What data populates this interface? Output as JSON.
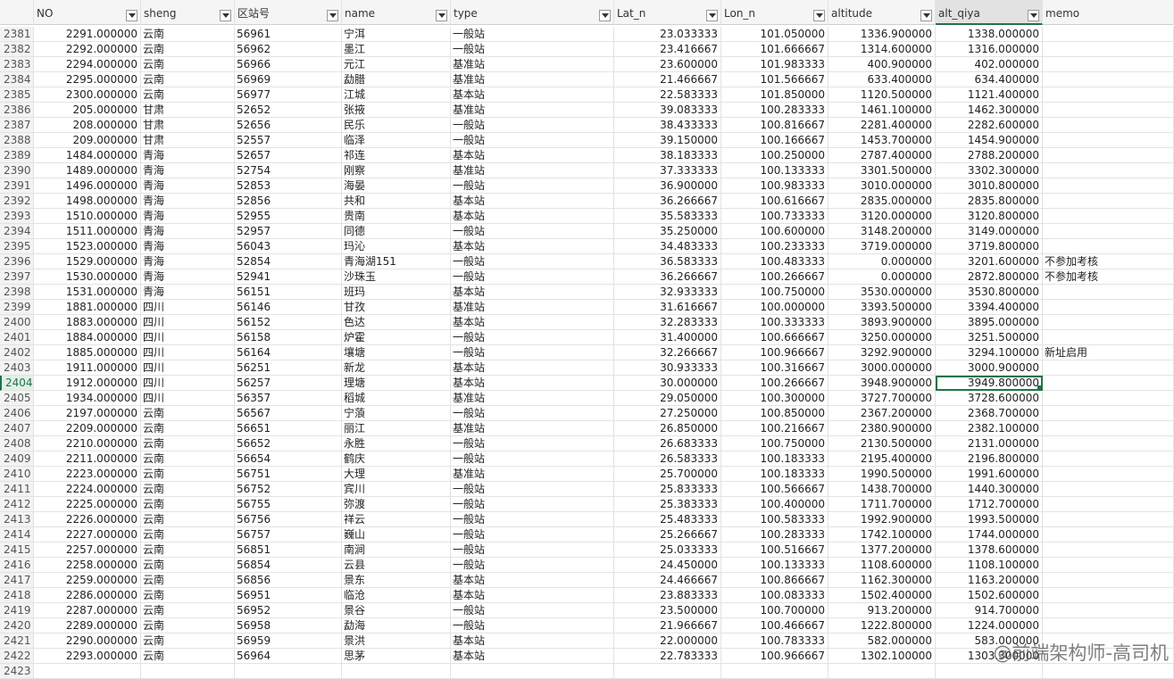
{
  "columns": [
    "NO",
    "sheng",
    "区站号",
    "name",
    "type",
    "Lat_n",
    "Lon_n",
    "altitude",
    "alt_qiya",
    "memo"
  ],
  "active_column": 8,
  "active_row": 2404,
  "rows": [
    [
      "2381",
      "2291.000000",
      "云南",
      "56961",
      "宁洱",
      "一般站",
      "23.033333",
      "101.050000",
      "1336.900000",
      "1338.000000",
      ""
    ],
    [
      "2382",
      "2292.000000",
      "云南",
      "56962",
      "墨江",
      "一般站",
      "23.416667",
      "101.666667",
      "1314.600000",
      "1316.000000",
      ""
    ],
    [
      "2383",
      "2294.000000",
      "云南",
      "56966",
      "元江",
      "基准站",
      "23.600000",
      "101.983333",
      "400.900000",
      "402.000000",
      ""
    ],
    [
      "2384",
      "2295.000000",
      "云南",
      "56969",
      "勐腊",
      "基准站",
      "21.466667",
      "101.566667",
      "633.400000",
      "634.400000",
      ""
    ],
    [
      "2385",
      "2300.000000",
      "云南",
      "56977",
      "江城",
      "基本站",
      "22.583333",
      "101.850000",
      "1120.500000",
      "1121.400000",
      ""
    ],
    [
      "2386",
      "205.000000",
      "甘肃",
      "52652",
      "张掖",
      "基准站",
      "39.083333",
      "100.283333",
      "1461.100000",
      "1462.300000",
      ""
    ],
    [
      "2387",
      "208.000000",
      "甘肃",
      "52656",
      "民乐",
      "一般站",
      "38.433333",
      "100.816667",
      "2281.400000",
      "2282.600000",
      ""
    ],
    [
      "2388",
      "209.000000",
      "甘肃",
      "52557",
      "临泽",
      "一般站",
      "39.150000",
      "100.166667",
      "1453.700000",
      "1454.900000",
      ""
    ],
    [
      "2389",
      "1484.000000",
      "青海",
      "52657",
      "祁连",
      "基本站",
      "38.183333",
      "100.250000",
      "2787.400000",
      "2788.200000",
      ""
    ],
    [
      "2390",
      "1489.000000",
      "青海",
      "52754",
      "刚察",
      "基准站",
      "37.333333",
      "100.133333",
      "3301.500000",
      "3302.300000",
      ""
    ],
    [
      "2391",
      "1496.000000",
      "青海",
      "52853",
      "海晏",
      "一般站",
      "36.900000",
      "100.983333",
      "3010.000000",
      "3010.800000",
      ""
    ],
    [
      "2392",
      "1498.000000",
      "青海",
      "52856",
      "共和",
      "基本站",
      "36.266667",
      "100.616667",
      "2835.000000",
      "2835.800000",
      ""
    ],
    [
      "2393",
      "1510.000000",
      "青海",
      "52955",
      "贵南",
      "基本站",
      "35.583333",
      "100.733333",
      "3120.000000",
      "3120.800000",
      ""
    ],
    [
      "2394",
      "1511.000000",
      "青海",
      "52957",
      "同德",
      "一般站",
      "35.250000",
      "100.600000",
      "3148.200000",
      "3149.000000",
      ""
    ],
    [
      "2395",
      "1523.000000",
      "青海",
      "56043",
      "玛沁",
      "基本站",
      "34.483333",
      "100.233333",
      "3719.000000",
      "3719.800000",
      ""
    ],
    [
      "2396",
      "1529.000000",
      "青海",
      "52854",
      "青海湖151",
      "一般站",
      "36.583333",
      "100.483333",
      "0.000000",
      "3201.600000",
      "不参加考核"
    ],
    [
      "2397",
      "1530.000000",
      "青海",
      "52941",
      "沙珠玉",
      "一般站",
      "36.266667",
      "100.266667",
      "0.000000",
      "2872.800000",
      "不参加考核"
    ],
    [
      "2398",
      "1531.000000",
      "青海",
      "56151",
      "班玛",
      "基本站",
      "32.933333",
      "100.750000",
      "3530.000000",
      "3530.800000",
      ""
    ],
    [
      "2399",
      "1881.000000",
      "四川",
      "56146",
      "甘孜",
      "基准站",
      "31.616667",
      "100.000000",
      "3393.500000",
      "3394.400000",
      ""
    ],
    [
      "2400",
      "1883.000000",
      "四川",
      "56152",
      "色达",
      "基本站",
      "32.283333",
      "100.333333",
      "3893.900000",
      "3895.000000",
      ""
    ],
    [
      "2401",
      "1884.000000",
      "四川",
      "56158",
      "炉霍",
      "一般站",
      "31.400000",
      "100.666667",
      "3250.000000",
      "3251.500000",
      ""
    ],
    [
      "2402",
      "1885.000000",
      "四川",
      "56164",
      "壤塘",
      "一般站",
      "32.266667",
      "100.966667",
      "3292.900000",
      "3294.100000",
      "新址启用"
    ],
    [
      "2403",
      "1911.000000",
      "四川",
      "56251",
      "新龙",
      "基本站",
      "30.933333",
      "100.316667",
      "3000.000000",
      "3000.900000",
      ""
    ],
    [
      "2404",
      "1912.000000",
      "四川",
      "56257",
      "理塘",
      "基本站",
      "30.000000",
      "100.266667",
      "3948.900000",
      "3949.800000",
      ""
    ],
    [
      "2405",
      "1934.000000",
      "四川",
      "56357",
      "稻城",
      "基准站",
      "29.050000",
      "100.300000",
      "3727.700000",
      "3728.600000",
      ""
    ],
    [
      "2406",
      "2197.000000",
      "云南",
      "56567",
      "宁蒗",
      "一般站",
      "27.250000",
      "100.850000",
      "2367.200000",
      "2368.700000",
      ""
    ],
    [
      "2407",
      "2209.000000",
      "云南",
      "56651",
      "丽江",
      "基准站",
      "26.850000",
      "100.216667",
      "2380.900000",
      "2382.100000",
      ""
    ],
    [
      "2408",
      "2210.000000",
      "云南",
      "56652",
      "永胜",
      "一般站",
      "26.683333",
      "100.750000",
      "2130.500000",
      "2131.000000",
      ""
    ],
    [
      "2409",
      "2211.000000",
      "云南",
      "56654",
      "鹤庆",
      "一般站",
      "26.583333",
      "100.183333",
      "2195.400000",
      "2196.800000",
      ""
    ],
    [
      "2410",
      "2223.000000",
      "云南",
      "56751",
      "大理",
      "基准站",
      "25.700000",
      "100.183333",
      "1990.500000",
      "1991.600000",
      ""
    ],
    [
      "2411",
      "2224.000000",
      "云南",
      "56752",
      "宾川",
      "一般站",
      "25.833333",
      "100.566667",
      "1438.700000",
      "1440.300000",
      ""
    ],
    [
      "2412",
      "2225.000000",
      "云南",
      "56755",
      "弥渡",
      "一般站",
      "25.383333",
      "100.400000",
      "1711.700000",
      "1712.700000",
      ""
    ],
    [
      "2413",
      "2226.000000",
      "云南",
      "56756",
      "祥云",
      "一般站",
      "25.483333",
      "100.583333",
      "1992.900000",
      "1993.500000",
      ""
    ],
    [
      "2414",
      "2227.000000",
      "云南",
      "56757",
      "巍山",
      "一般站",
      "25.266667",
      "100.283333",
      "1742.100000",
      "1744.000000",
      ""
    ],
    [
      "2415",
      "2257.000000",
      "云南",
      "56851",
      "南涧",
      "一般站",
      "25.033333",
      "100.516667",
      "1377.200000",
      "1378.600000",
      ""
    ],
    [
      "2416",
      "2258.000000",
      "云南",
      "56854",
      "云县",
      "一般站",
      "24.450000",
      "100.133333",
      "1108.600000",
      "1108.100000",
      ""
    ],
    [
      "2417",
      "2259.000000",
      "云南",
      "56856",
      "景东",
      "基本站",
      "24.466667",
      "100.866667",
      "1162.300000",
      "1163.200000",
      ""
    ],
    [
      "2418",
      "2286.000000",
      "云南",
      "56951",
      "临沧",
      "基本站",
      "23.883333",
      "100.083333",
      "1502.400000",
      "1502.600000",
      ""
    ],
    [
      "2419",
      "2287.000000",
      "云南",
      "56952",
      "景谷",
      "一般站",
      "23.500000",
      "100.700000",
      "913.200000",
      "914.700000",
      ""
    ],
    [
      "2420",
      "2289.000000",
      "云南",
      "56958",
      "勐海",
      "一般站",
      "21.966667",
      "100.466667",
      "1222.800000",
      "1224.000000",
      ""
    ],
    [
      "2421",
      "2290.000000",
      "云南",
      "56959",
      "景洪",
      "基本站",
      "22.000000",
      "100.783333",
      "582.000000",
      "583.000000",
      ""
    ],
    [
      "2422",
      "2293.000000",
      "云南",
      "56964",
      "思茅",
      "基本站",
      "22.783333",
      "100.966667",
      "1302.100000",
      "1303.300000",
      ""
    ],
    [
      "2423",
      "",
      "",
      "",
      "",
      "",
      "",
      "",
      "",
      "",
      ""
    ]
  ],
  "watermark": "@前端架构师-高司机"
}
